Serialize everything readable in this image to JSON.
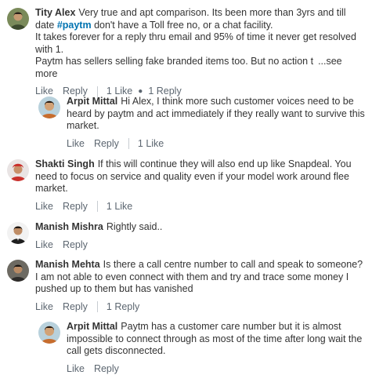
{
  "comments": [
    {
      "author": "Tity Alex",
      "text_before_tag": "Very true and apt comparison. Its been more than 3yrs and till date ",
      "hashtag": "#paytm",
      "text_after_tag": " don't have a Toll free no, or a chat facility.",
      "line2": "It takes forever for a reply thru email and 95% of time it never get resolved with 1.",
      "line3": "Paytm has sellers selling fake branded items too. But no action t",
      "see_more": "...see more",
      "like_label": "Like",
      "reply_label": "Reply",
      "likes_count": "1 Like",
      "replies_count": "1 Reply",
      "avatar_icon": "profile-photo-icon"
    },
    {
      "author": "Arpit Mittal",
      "text": "Hi Alex, I think more such customer voices need to be heard by paytm and act immediately if they really want to survive this market.",
      "like_label": "Like",
      "reply_label": "Reply",
      "likes_count": "1 Like",
      "avatar_icon": "profile-photo-icon"
    },
    {
      "author": "Shakti Singh",
      "text": "If this will continue they will also end up like Snapdeal.  You need to focus on service and quality even if your model work around flee market.",
      "like_label": "Like",
      "reply_label": "Reply",
      "likes_count": "1 Like",
      "avatar_icon": "profile-photo-icon"
    },
    {
      "author": "Manish Mishra",
      "text": "Rightly said..",
      "like_label": "Like",
      "reply_label": "Reply",
      "avatar_icon": "profile-photo-icon"
    },
    {
      "author": "Manish Mehta",
      "text": "Is there a call centre number to call and speak to someone? I am not able to even connect with them and try and trace some money I pushed up to them but has vanished",
      "like_label": "Like",
      "reply_label": "Reply",
      "replies_count": "1 Reply",
      "avatar_icon": "profile-photo-icon"
    },
    {
      "author": "Arpit Mittal",
      "text": "Paytm has a customer care number but it is almost impossible to connect through as most of the time after long wait the call gets disconnected.",
      "like_label": "Like",
      "reply_label": "Reply",
      "avatar_icon": "profile-photo-icon"
    }
  ]
}
